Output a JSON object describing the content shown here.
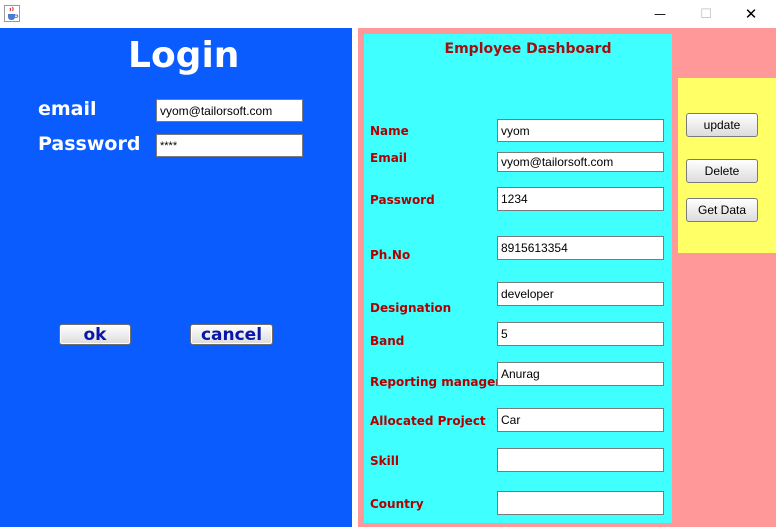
{
  "window": {
    "icons": {
      "app": "java-cup-icon",
      "minimize": "minimize-icon",
      "maximize": "maximize-icon",
      "close": "close-icon"
    },
    "controls": {
      "minimize": "—",
      "maximize": "☐",
      "close": "✕"
    }
  },
  "login": {
    "title": "Login",
    "email_label": "email",
    "email_value": "vyom@tailorsoft.com",
    "password_label": "Password",
    "password_value": "****",
    "ok_label": "ok",
    "cancel_label": "cancel"
  },
  "dashboard": {
    "title": "Employee Dashboard",
    "fields": {
      "name": {
        "label": "Name",
        "value": "vyom"
      },
      "email": {
        "label": "Email",
        "value": "vyom@tailorsoft.com"
      },
      "password": {
        "label": "Password",
        "value": "1234"
      },
      "phone": {
        "label": "Ph.No",
        "value": "8915613354"
      },
      "designation": {
        "label": "Designation",
        "value": "developer"
      },
      "band": {
        "label": "Band",
        "value": "5"
      },
      "reporting_manager": {
        "label": "Reporting manager",
        "value": "Anurag"
      },
      "allocated_project": {
        "label": "Allocated Project",
        "value": "Car"
      },
      "skill": {
        "label": "Skill",
        "value": ""
      },
      "country": {
        "label": "Country",
        "value": ""
      }
    }
  },
  "actions": {
    "update_label": "update",
    "delete_label": "Delete",
    "get_data_label": "Get Data"
  },
  "colors": {
    "login_bg": "#0a5cff",
    "pink_bg": "#ff9999",
    "cyan_bg": "#40ffff",
    "yellow_bg": "#ffff66",
    "label_red": "#b00000",
    "button_text_blue": "#0a16a8"
  }
}
